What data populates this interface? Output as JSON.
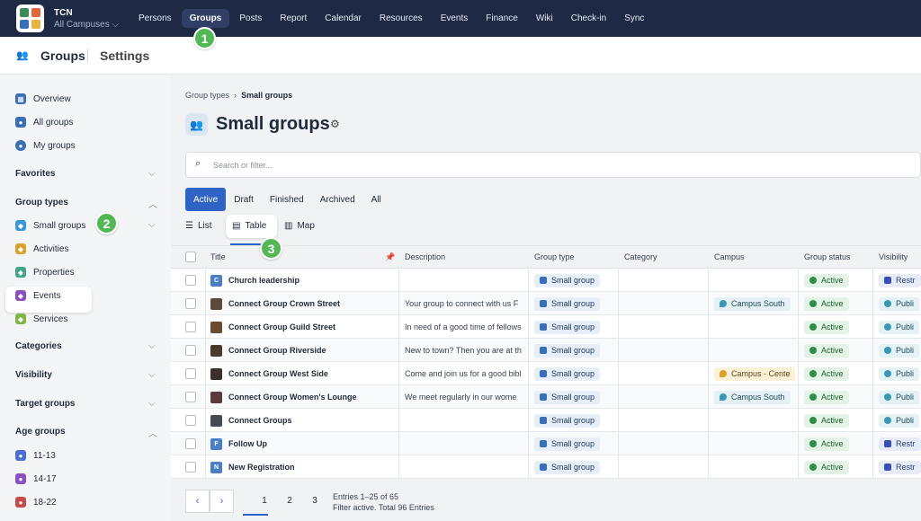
{
  "org": {
    "name": "TCN",
    "campus": "All Campuses"
  },
  "nav": [
    "Persons",
    "Groups",
    "Posts",
    "Report",
    "Calendar",
    "Resources",
    "Events",
    "Finance",
    "Wiki",
    "Check-in",
    "Sync"
  ],
  "header": {
    "groups": "Groups",
    "settings": "Settings"
  },
  "sidebar": {
    "top_items": [
      "Overview",
      "All groups",
      "My groups"
    ],
    "favorites": "Favorites",
    "group_types": "Group types",
    "types": [
      "Small groups",
      "Activities",
      "Properties",
      "Events",
      "Services"
    ],
    "categories": "Categories",
    "visibility": "Visibility",
    "target_groups": "Target groups",
    "age_groups": "Age groups",
    "ages": [
      "11-13",
      "14-17",
      "18-22"
    ]
  },
  "breadcrumb": {
    "parent": "Group types",
    "current": "Small groups"
  },
  "page_title": "Small groups",
  "search_placeholder": "Search or filter...",
  "status_tabs": [
    "Active",
    "Draft",
    "Finished",
    "Archived",
    "All"
  ],
  "view_tabs": [
    "List",
    "Table",
    "Map"
  ],
  "columns": [
    "Title",
    "Description",
    "Group type",
    "Category",
    "Campus",
    "Group status",
    "Visibility"
  ],
  "rows": [
    {
      "title": "Church leadership",
      "thumb": "C",
      "thumb_color": "#4a7fc6",
      "description": "",
      "type": "Small group",
      "campus": "",
      "status": "Active",
      "visibility": "Restr"
    },
    {
      "title": "Connect Group Crown Street",
      "thumb": "",
      "thumb_color": "#5b4a3a",
      "description": "Your group to connect with us F",
      "type": "Small group",
      "campus": "Campus South",
      "status": "Active",
      "visibility": "Publi"
    },
    {
      "title": "Connect Group Guild Street",
      "thumb": "",
      "thumb_color": "#6b4a32",
      "description": "In need of a good time of fellows",
      "type": "Small group",
      "campus": "",
      "status": "Active",
      "visibility": "Publi"
    },
    {
      "title": "Connect Group Riverside",
      "thumb": "",
      "thumb_color": "#4a3a2a",
      "description": "New to town? Then you are at th",
      "type": "Small group",
      "campus": "",
      "status": "Active",
      "visibility": "Publi"
    },
    {
      "title": "Connect Group West Side",
      "thumb": "",
      "thumb_color": "#3a2f2a",
      "description": "Come and join us for a good bibl",
      "type": "Small group",
      "campus": "Campus - Cente",
      "status": "Active",
      "visibility": "Publi"
    },
    {
      "title": "Connect Group Women's Lounge",
      "thumb": "",
      "thumb_color": "#5a3a3a",
      "description": "We meet regularly in our wome",
      "type": "Small group",
      "campus": "Campus South",
      "status": "Active",
      "visibility": "Publi"
    },
    {
      "title": "Connect Groups",
      "thumb": "",
      "thumb_color": "#444a52",
      "description": "",
      "type": "Small group",
      "campus": "",
      "status": "Active",
      "visibility": "Publi"
    },
    {
      "title": "Follow Up",
      "thumb": "F",
      "thumb_color": "#4a7fc6",
      "description": "",
      "type": "Small group",
      "campus": "",
      "status": "Active",
      "visibility": "Restr"
    },
    {
      "title": "New Registration",
      "thumb": "N",
      "thumb_color": "#4a7fc6",
      "description": "",
      "type": "Small group",
      "campus": "",
      "status": "Active",
      "visibility": "Restr"
    }
  ],
  "pagination": {
    "pages": [
      "1",
      "2",
      "3"
    ],
    "prev": "‹",
    "next": "›",
    "entries_line1": "Entries 1–25 of 65",
    "entries_line2": "Filter active. Total 96 Entries"
  },
  "markers": [
    "1",
    "2",
    "3"
  ],
  "colors": {
    "nav_bg": "#1e2a45",
    "accent": "#2f64c6",
    "marker": "#54b755"
  }
}
